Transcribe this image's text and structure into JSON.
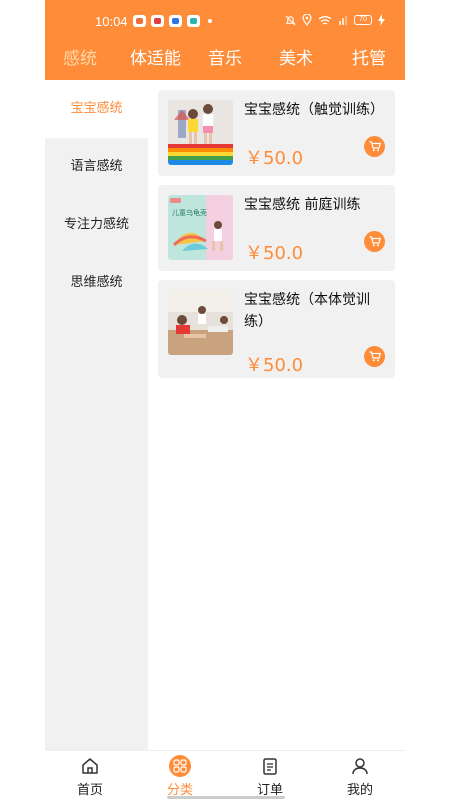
{
  "status_bar": {
    "time": "10:04",
    "battery": "70"
  },
  "tabs": [
    {
      "label": "感统",
      "active": true
    },
    {
      "label": "体适能",
      "active": false
    },
    {
      "label": "音乐",
      "active": false
    },
    {
      "label": "美术",
      "active": false
    },
    {
      "label": "托管",
      "active": false
    }
  ],
  "sidebar": {
    "items": [
      {
        "label": "宝宝感统",
        "active": true
      },
      {
        "label": "语言感统",
        "active": false
      },
      {
        "label": "专注力感统",
        "active": false
      },
      {
        "label": "思维感统",
        "active": false
      }
    ]
  },
  "products": [
    {
      "title": "宝宝感统（触觉训练）",
      "price": "￥50.0",
      "image": "children-on-rainbow-mat-photo"
    },
    {
      "title": "宝宝感统 前庭训练",
      "price": "￥50.0",
      "image": "balance-board-toy-photo",
      "image_text": "儿童乌龟壳"
    },
    {
      "title": "宝宝感统（本体觉训练）",
      "price": "￥50.0",
      "image": "children-crawling-training-photo"
    }
  ],
  "bottom_nav": [
    {
      "label": "首页",
      "icon": "home-icon",
      "active": false
    },
    {
      "label": "分类",
      "icon": "category-icon",
      "active": true
    },
    {
      "label": "订单",
      "icon": "order-icon",
      "active": false
    },
    {
      "label": "我的",
      "icon": "profile-icon",
      "active": false
    }
  ],
  "colors": {
    "accent": "#FF8C38",
    "sidebar_bg": "#F1F1F1",
    "card_bg": "#F1F1F1"
  }
}
